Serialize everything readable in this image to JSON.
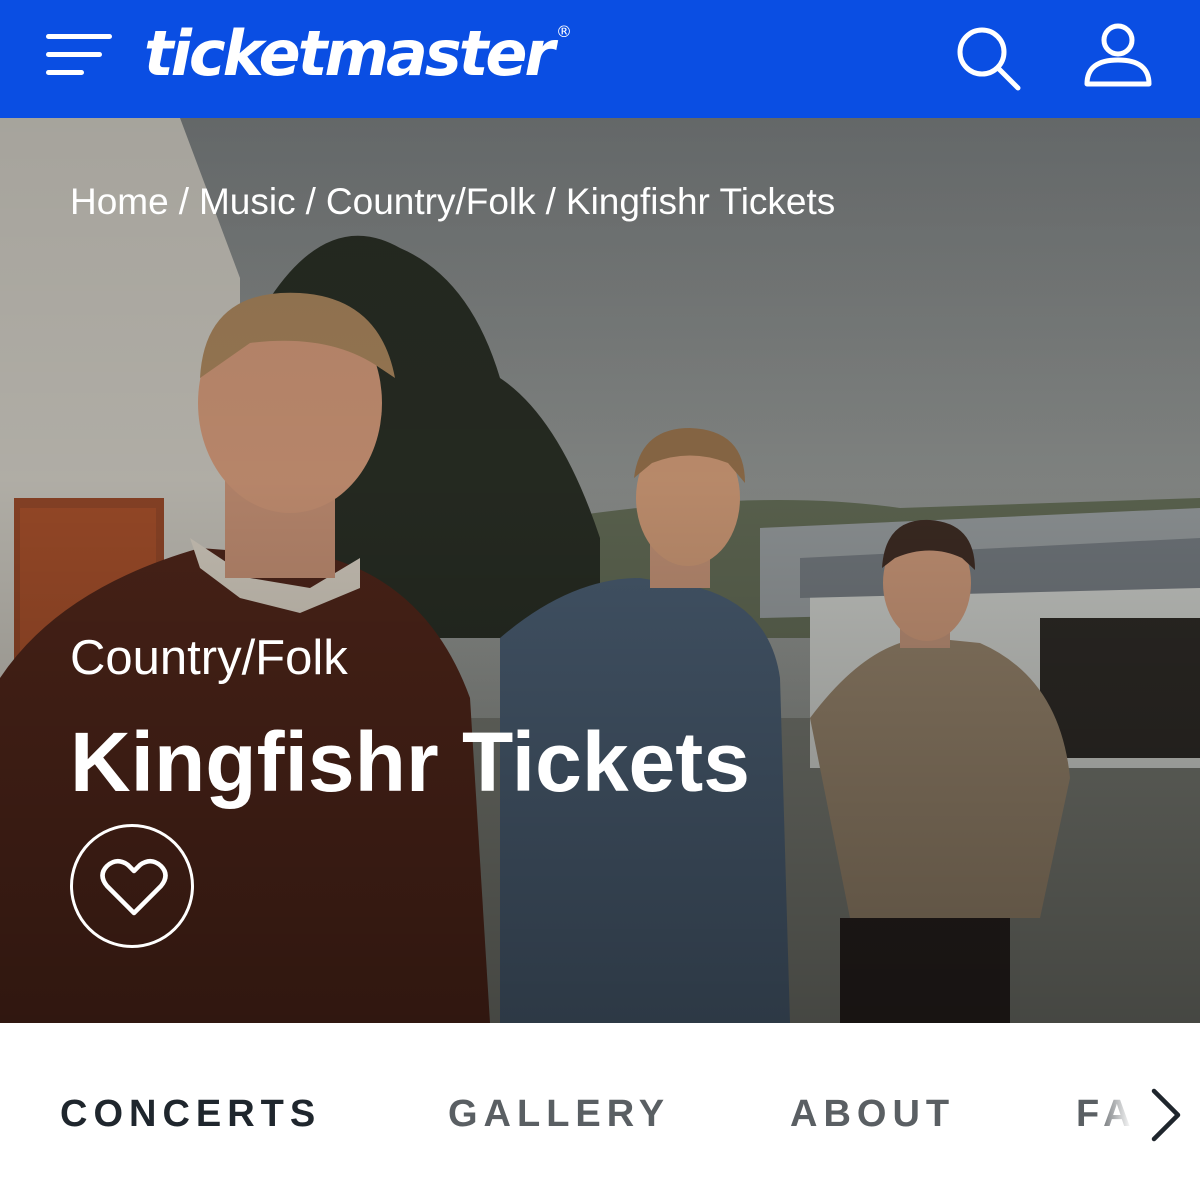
{
  "header": {
    "menu_icon": "hamburger-menu-icon",
    "logo_text": "ticketmaster",
    "logo_mark": "®",
    "search_icon": "search-icon",
    "account_icon": "user-account-icon",
    "background_color": "#0a4ee3"
  },
  "breadcrumb": {
    "items": [
      "Home",
      "Music",
      "Country/Folk",
      "Kingfishr Tickets"
    ],
    "separator": "/"
  },
  "hero": {
    "genre": "Country/Folk",
    "title": "Kingfishr Tickets",
    "favorite_icon": "heart-outline-icon"
  },
  "tabs": {
    "items": [
      "CONCERTS",
      "GALLERY",
      "ABOUT",
      "FAQ"
    ],
    "next_icon": "chevron-right-icon"
  }
}
